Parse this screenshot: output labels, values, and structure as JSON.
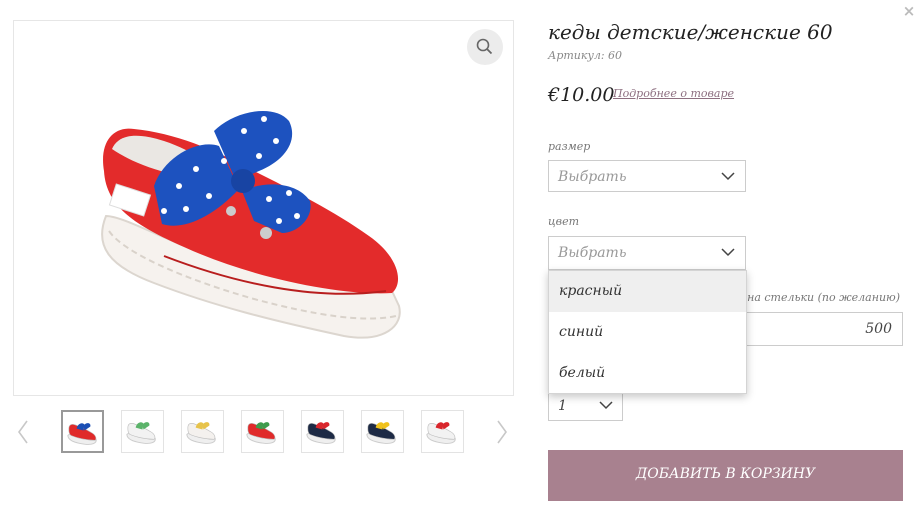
{
  "close": {
    "icon": "close-icon",
    "symbol": "×"
  },
  "product": {
    "title": "кеды детские/женские 60",
    "sku_label": "Артикул:",
    "sku_value": "60",
    "price": "€10.00",
    "details_link": "Подробнее о товаре"
  },
  "options": {
    "size": {
      "label": "размер",
      "placeholder": "Выбрать"
    },
    "color": {
      "label": "цвет",
      "placeholder": "Выбрать",
      "dropdown_open": true,
      "items": [
        "красный",
        "синий",
        "белый"
      ],
      "highlighted_index": 0
    },
    "insole": {
      "label": "лина стельки (по желанию)",
      "value": "500"
    },
    "quantity": {
      "value": "1"
    }
  },
  "cart_button": {
    "label": "ДОБАВИТЬ В КОРЗИНУ"
  },
  "gallery": {
    "zoom_icon": "magnifier-icon",
    "prev_icon": "chevron-left-icon",
    "next_icon": "chevron-right-icon",
    "active_index": 0,
    "thumbnails": [
      {
        "name": "red-shoe-blue-bow",
        "shoe": "#e02a2a",
        "bow": "#1b4fb5"
      },
      {
        "name": "white-shoe-green-bow",
        "shoe": "#f2f2f2",
        "bow": "#5bb36a"
      },
      {
        "name": "white-shoe-yellow-bow",
        "shoe": "#f4f1ee",
        "bow": "#e7c34a"
      },
      {
        "name": "red-shoe-green-bow",
        "shoe": "#e02a2a",
        "bow": "#3f9b4c"
      },
      {
        "name": "navy-shoe-red-bow",
        "shoe": "#1d2a45",
        "bow": "#d9262c"
      },
      {
        "name": "navy-shoe-yellow-bow",
        "shoe": "#1d2a45",
        "bow": "#f0c21c"
      },
      {
        "name": "white-shoe-red-bow",
        "shoe": "#f2f2f2",
        "bow": "#d9262c"
      }
    ]
  },
  "colors": {
    "accent": "#a8818f",
    "link": "#8d6f80",
    "highlight": "#efefef"
  }
}
